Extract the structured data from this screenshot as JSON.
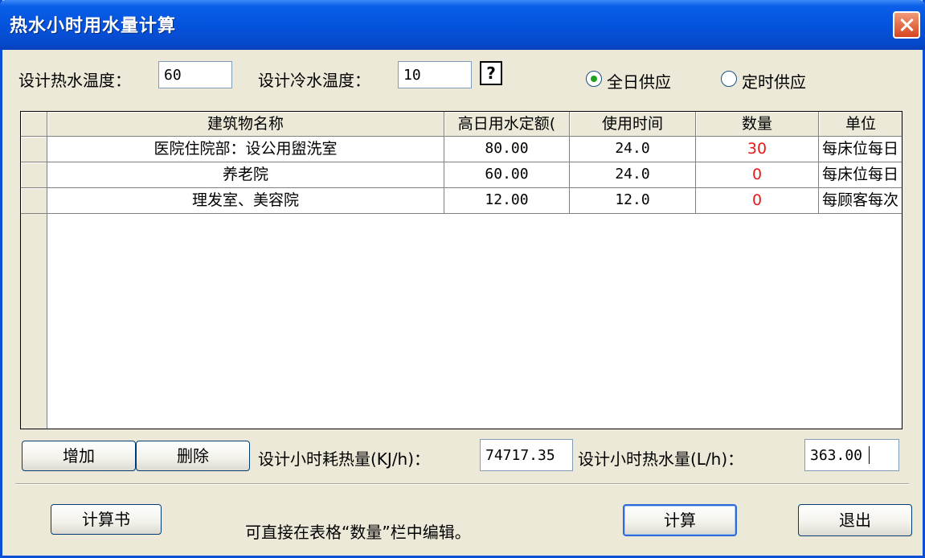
{
  "window": {
    "title": "热水小时用水量计算"
  },
  "inputs": {
    "hot_water_temp_label": "设计热水温度：",
    "hot_water_temp_value": "60",
    "cold_water_temp_label": "设计冷水温度：",
    "cold_water_temp_value": "10",
    "help_label": "?"
  },
  "supply_mode": {
    "options": [
      {
        "label": "全日供应",
        "selected": true
      },
      {
        "label": "定时供应",
        "selected": false
      }
    ]
  },
  "table": {
    "columns": [
      "建筑物名称",
      "高日用水定额(",
      "使用时间",
      "数量",
      "单位"
    ],
    "rows": [
      {
        "name": "医院住院部：设公用盥洗室",
        "quota": "80.00",
        "hours": "24.0",
        "count": "30",
        "unit": "每床位每日"
      },
      {
        "name": "养老院",
        "quota": "60.00",
        "hours": "24.0",
        "count": "0",
        "unit": "每床位每日"
      },
      {
        "name": "理发室、美容院",
        "quota": "12.00",
        "hours": "12.0",
        "count": "0",
        "unit": "每顾客每次"
      }
    ]
  },
  "actions": {
    "add_label": "增加",
    "delete_label": "删除",
    "heat_label": "设计小时耗热量(KJ/h)：",
    "heat_value": "74717.35",
    "water_label": "设计小时热水量(L/h)：",
    "water_value": "363.00"
  },
  "footer": {
    "report_label": "计算书",
    "hint": "可直接在表格“数量”栏中编辑。",
    "calc_label": "计算",
    "exit_label": "退出"
  },
  "colors": {
    "title_bar": "#0553dc",
    "count_text": "#e41b1b",
    "dialog_bg": "#ece9d8"
  }
}
